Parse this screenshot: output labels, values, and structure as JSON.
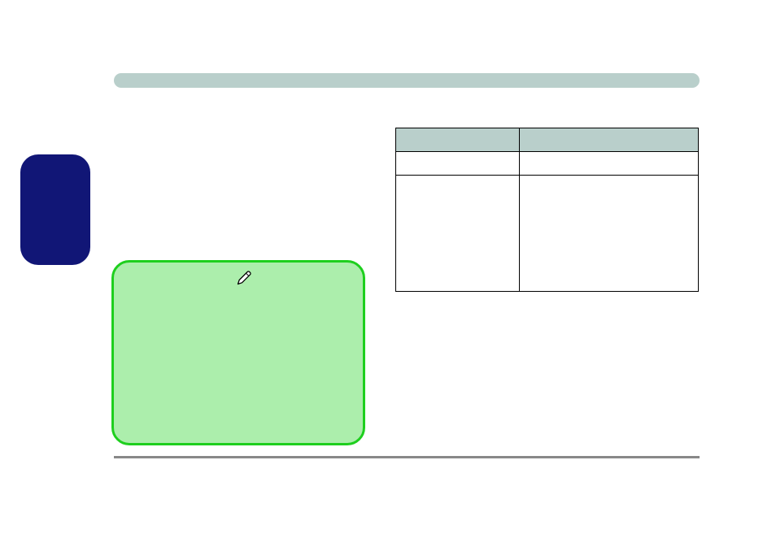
{
  "colors": {
    "header_bar": "#b9cfcb",
    "navy_block": "#111676",
    "green_panel_fill": "#aceeac",
    "green_panel_border": "#1ecf1e",
    "table_header": "#b9cfcb",
    "bottom_rule": "#888888"
  },
  "icons": {
    "pen": "pen-icon"
  },
  "table": {
    "headers": [
      "",
      ""
    ],
    "rows": [
      [
        "",
        ""
      ],
      [
        "",
        ""
      ]
    ]
  }
}
